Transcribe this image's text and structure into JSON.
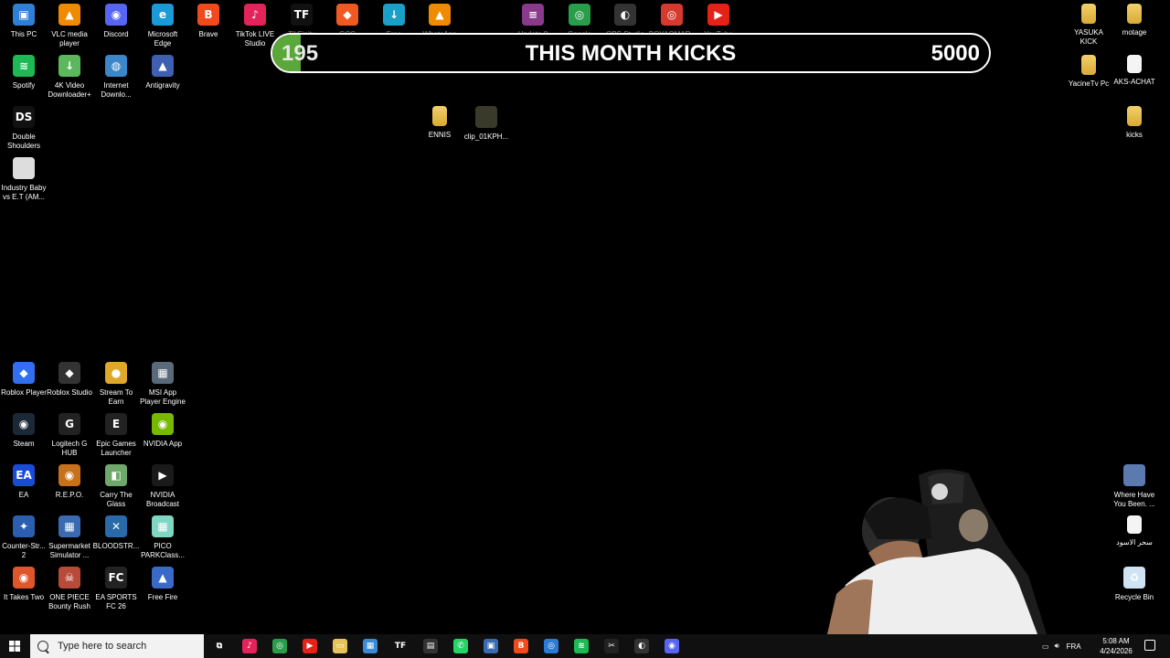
{
  "desktop": {
    "icons": [
      {
        "label": "This PC",
        "icon": "this-pc-icon",
        "color": "#2f7fd6",
        "glyph": "▣"
      },
      {
        "label": "VLC media player",
        "icon": "vlc-icon",
        "color": "#f08a00",
        "glyph": "▲"
      },
      {
        "label": "Discord",
        "icon": "discord-icon",
        "color": "#5865f2",
        "glyph": "◉"
      },
      {
        "label": "Microsoft Edge",
        "icon": "edge-icon",
        "color": "#1a9ad6",
        "glyph": "e"
      },
      {
        "label": "Brave",
        "icon": "brave-icon",
        "color": "#f24a1d",
        "glyph": "B"
      },
      {
        "label": "TikTok LIVE Studio",
        "icon": "tiktok-live-icon",
        "color": "#e3245a",
        "glyph": "♪"
      },
      {
        "label": "TikFinity",
        "icon": "tikfinity-icon",
        "color": "#111",
        "glyph": "TF"
      },
      {
        "label": "GCC",
        "icon": "gcc-icon",
        "color": "#f05a22",
        "glyph": "◆"
      },
      {
        "label": "Free Downlo...",
        "icon": "free-download-icon",
        "color": "#1aa0c8",
        "glyph": "↓"
      },
      {
        "label": "WhatsApp Video 2026-...",
        "icon": "whatsapp-video-icon",
        "color": "#f08a00",
        "glyph": "▲"
      },
      {
        "label": "Update 8",
        "icon": "winrar-icon",
        "color": "#8a3a8a",
        "glyph": "≡"
      },
      {
        "label": "Google Chrome",
        "icon": "chrome-icon",
        "color": "#2a9d4b",
        "glyph": "◎"
      },
      {
        "label": "OBS Studio",
        "icon": "obs-icon",
        "color": "#333",
        "glyph": "◐"
      },
      {
        "label": "BOYAOMAR - Chrome",
        "icon": "chrome-profile-icon",
        "color": "#d63a2f",
        "glyph": "◎"
      },
      {
        "label": "YouTube",
        "icon": "youtube-icon",
        "color": "#e62117",
        "glyph": "▶"
      },
      {
        "label": "YASUKA KICK",
        "icon": "folder-icon",
        "color": "#e6c35a",
        "glyph": ""
      },
      {
        "label": "motage",
        "icon": "folder-icon",
        "color": "#e6c35a",
        "glyph": ""
      },
      {
        "label": "Spotify",
        "icon": "spotify-icon",
        "color": "#1db954",
        "glyph": "≋"
      },
      {
        "label": "4K Video Downloader+",
        "icon": "4k-downloader-icon",
        "color": "#5cb85c",
        "glyph": "↓"
      },
      {
        "label": "Internet Downlo...",
        "icon": "idm-icon",
        "color": "#3b87c9",
        "glyph": "◍"
      },
      {
        "label": "Antigravity",
        "icon": "antigravity-icon",
        "color": "#3f5fb0",
        "glyph": "▲"
      },
      {
        "label": "YacineTv Pc",
        "icon": "folder-icon",
        "color": "#e6c35a",
        "glyph": ""
      },
      {
        "label": "AKS-ACHAT",
        "icon": "file-icon",
        "color": "#f4f4f4",
        "glyph": ""
      },
      {
        "label": "ENNIS",
        "icon": "folder-icon",
        "color": "#e6c35a",
        "glyph": ""
      },
      {
        "label": "clip_01KPH...",
        "icon": "video-thumbnail-icon",
        "color": "#3a3a2a",
        "glyph": ""
      },
      {
        "label": "kicks",
        "icon": "folder-icon",
        "color": "#e6c35a",
        "glyph": ""
      },
      {
        "label": "Double Shoulders",
        "icon": "double-shoulders-icon",
        "color": "#111",
        "glyph": "DS"
      },
      {
        "label": "Industry Baby vs E.T (AM...",
        "icon": "media-file-icon",
        "color": "#ddd",
        "glyph": ""
      },
      {
        "label": "Roblox Player",
        "icon": "roblox-icon",
        "color": "#2f6ff0",
        "glyph": "◆"
      },
      {
        "label": "Roblox Studio",
        "icon": "roblox-studio-icon",
        "color": "#333",
        "glyph": "◆"
      },
      {
        "label": "Stream To Earn",
        "icon": "stream-to-earn-icon",
        "color": "#e0a82b",
        "glyph": "●"
      },
      {
        "label": "MSI App Player Engine",
        "icon": "msi-app-player-icon",
        "color": "#5a6a7a",
        "glyph": "▦"
      },
      {
        "label": "Steam",
        "icon": "steam-icon",
        "color": "#1b2838",
        "glyph": "◉"
      },
      {
        "label": "Logitech G HUB",
        "icon": "logitech-icon",
        "color": "#222",
        "glyph": "G"
      },
      {
        "label": "Epic Games Launcher",
        "icon": "epic-games-icon",
        "color": "#222",
        "glyph": "E"
      },
      {
        "label": "NVIDIA App",
        "icon": "nvidia-app-icon",
        "color": "#76b900",
        "glyph": "◉"
      },
      {
        "label": "EA",
        "icon": "ea-icon",
        "color": "#1a4bd6",
        "glyph": "EA"
      },
      {
        "label": "R.E.P.O.",
        "icon": "repo-icon",
        "color": "#c8711d",
        "glyph": "◉"
      },
      {
        "label": "Carry The Glass",
        "icon": "carry-the-glass-icon",
        "color": "#6fa86a",
        "glyph": "◧"
      },
      {
        "label": "NVIDIA Broadcast",
        "icon": "nvidia-broadcast-icon",
        "color": "#1a1a1a",
        "glyph": "▶"
      },
      {
        "label": "Where Have You Been. ...",
        "icon": "media-file-icon",
        "color": "#5a7ab0",
        "glyph": ""
      },
      {
        "label": "Counter-Str... 2",
        "icon": "cs2-icon",
        "color": "#2a5fb0",
        "glyph": "✦"
      },
      {
        "label": "Supermarket Simulator ...",
        "icon": "supermarket-icon",
        "color": "#3a6ab0",
        "glyph": "▦"
      },
      {
        "label": "BLOODSTR...",
        "icon": "bloodstrike-icon",
        "color": "#2a6aa8",
        "glyph": "✕"
      },
      {
        "label": "PICO PARKClass...",
        "icon": "pico-park-icon",
        "color": "#7fd6c2",
        "glyph": "▦"
      },
      {
        "label": "سحر الاسود",
        "icon": "file-icon",
        "color": "#f4f4f4",
        "glyph": ""
      },
      {
        "label": "It Takes Two",
        "icon": "it-takes-two-icon",
        "color": "#e0562b",
        "glyph": "◉"
      },
      {
        "label": "ONE PIECE Bounty Rush",
        "icon": "one-piece-icon",
        "color": "#b84a3a",
        "glyph": "☠"
      },
      {
        "label": "EA SPORTS FC 26",
        "icon": "ea-fc-icon",
        "color": "#222",
        "glyph": "FC"
      },
      {
        "label": "Free Fire",
        "icon": "free-fire-icon",
        "color": "#3a6ac8",
        "glyph": "▲"
      },
      {
        "label": "Recycle Bin",
        "icon": "recycle-bin-icon",
        "color": "#cfe3f3",
        "glyph": "♻"
      }
    ]
  },
  "overlay": {
    "current": "195",
    "title": "THIS MONTH KICKS",
    "target": "5000",
    "progress_fraction": 0.039,
    "fill_color": "#5aa73a"
  },
  "taskbar": {
    "search_placeholder": "Type here to search",
    "apps": [
      {
        "icon": "task-view-icon",
        "color": "transparent",
        "glyph": "⧉"
      },
      {
        "icon": "tiktok-taskbar-icon",
        "color": "#e3245a",
        "glyph": "♪"
      },
      {
        "icon": "chrome-taskbar-icon",
        "color": "#2a9d4b",
        "glyph": "◎"
      },
      {
        "icon": "youtube-taskbar-icon",
        "color": "#e62117",
        "glyph": "▶"
      },
      {
        "icon": "file-explorer-icon",
        "color": "#e6c35a",
        "glyph": "▭"
      },
      {
        "icon": "store-icon",
        "color": "#3a8ad6",
        "glyph": "▦"
      },
      {
        "icon": "tikfinity-taskbar-icon",
        "color": "#111",
        "glyph": "TF"
      },
      {
        "icon": "terminal-icon",
        "color": "#333",
        "glyph": "▤"
      },
      {
        "icon": "whatsapp-icon",
        "color": "#25d366",
        "glyph": "✆"
      },
      {
        "icon": "remote-desktop-icon",
        "color": "#3a6ab0",
        "glyph": "▣"
      },
      {
        "icon": "brave-taskbar-icon",
        "color": "#f24a1d",
        "glyph": "B"
      },
      {
        "icon": "chrome-profile-taskbar-icon",
        "color": "#2a7ad6",
        "glyph": "◎"
      },
      {
        "icon": "spotify-taskbar-icon",
        "color": "#1db954",
        "glyph": "≋"
      },
      {
        "icon": "capcut-icon",
        "color": "#222",
        "glyph": "✂"
      },
      {
        "icon": "obs-taskbar-icon",
        "color": "#333",
        "glyph": "◐"
      },
      {
        "icon": "discord-taskbar-icon",
        "color": "#5865f2",
        "glyph": "◉"
      }
    ],
    "language": "FRA",
    "time": "5:08 AM",
    "date": "4/24/2026"
  }
}
